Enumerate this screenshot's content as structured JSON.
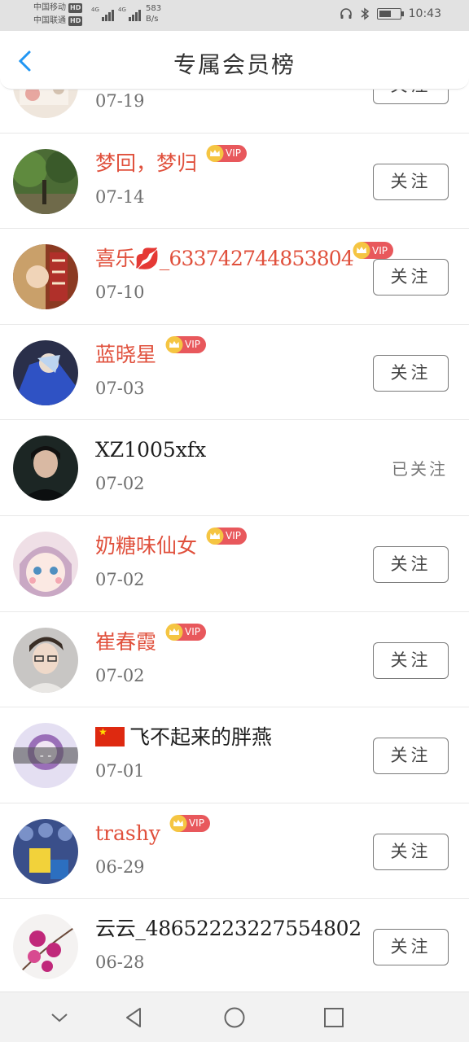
{
  "status_bar": {
    "carrier1": "中国移动",
    "carrier2": "中国联通",
    "hd_badge": "HD",
    "network": "4G",
    "speed_value": "583",
    "speed_unit": "B/s",
    "time": "10:43",
    "battery_level": 0.6
  },
  "header": {
    "title": "专属会员榜"
  },
  "labels": {
    "follow": "关注",
    "followed": "已关注",
    "vip": "VIP"
  },
  "members": [
    {
      "name": "",
      "date": "07-19",
      "vip": false,
      "following": false
    },
    {
      "name": "梦回，梦归",
      "date": "07-14",
      "vip": true,
      "following": false
    },
    {
      "name": "喜乐💋_633742744853804",
      "date": "07-10",
      "vip": true,
      "following": false
    },
    {
      "name": "蓝晓星",
      "date": "07-03",
      "vip": true,
      "following": false
    },
    {
      "name": "XZ1005xfx",
      "date": "07-02",
      "vip": false,
      "following": true
    },
    {
      "name": "奶糖味仙女",
      "date": "07-02",
      "vip": true,
      "following": false
    },
    {
      "name": "崔春霞",
      "date": "07-02",
      "vip": true,
      "following": false
    },
    {
      "name": "飞不起来的胖燕",
      "date": "07-01",
      "vip": false,
      "following": false
    },
    {
      "name": "trashy",
      "date": "06-29",
      "vip": true,
      "following": false
    },
    {
      "name": "云云_48652223227554802",
      "date": "06-28",
      "vip": false,
      "following": false
    }
  ],
  "colors": {
    "vip_name": "#e0503c",
    "vip_badge": "#e8585c",
    "back_arrow": "#2196f3",
    "status_bar_bg": "#e2e2e2"
  },
  "icons": {
    "back": "chevron-left-icon",
    "crown": "crown-icon",
    "nav_collapse": "chevron-down-icon",
    "nav_back": "triangle-back-icon",
    "nav_home": "circle-home-icon",
    "nav_recent": "square-recent-icon"
  }
}
